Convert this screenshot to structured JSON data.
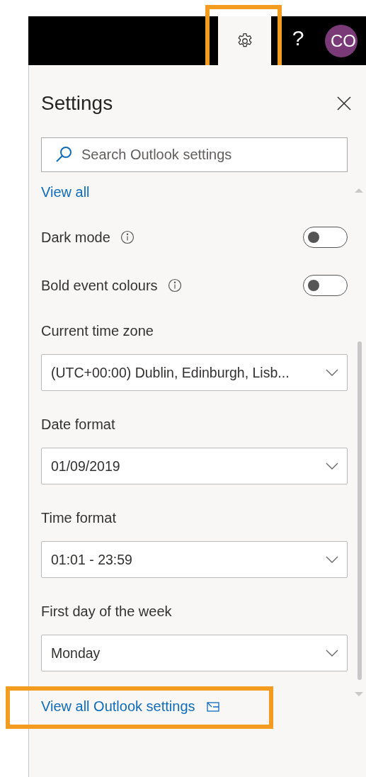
{
  "top_bar": {
    "buttons": [
      {
        "kind": "settings",
        "selected": true,
        "highlighted": true
      },
      {
        "kind": "help",
        "label": "?",
        "selected": false
      }
    ],
    "avatar": "CO"
  },
  "settings": {
    "title": "Settings",
    "search": {
      "placeholder": "Search Outlook settings"
    },
    "view_all": "View all",
    "toggles": [
      {
        "label": "Dark mode",
        "on": false
      },
      {
        "label": "Bold event colours",
        "on": false
      }
    ],
    "dropdowns": [
      {
        "label": "Current time zone",
        "value": "(UTC+00:00) Dublin, Edinburgh, Lisb..."
      },
      {
        "label": "Date format",
        "value": "01/09/2019"
      },
      {
        "label": "Time format",
        "value": "01:01 - 23:59"
      },
      {
        "label": "First day of the week",
        "value": "Monday"
      }
    ],
    "footer_link": {
      "label": "View all Outlook settings",
      "highlighted": true
    }
  }
}
